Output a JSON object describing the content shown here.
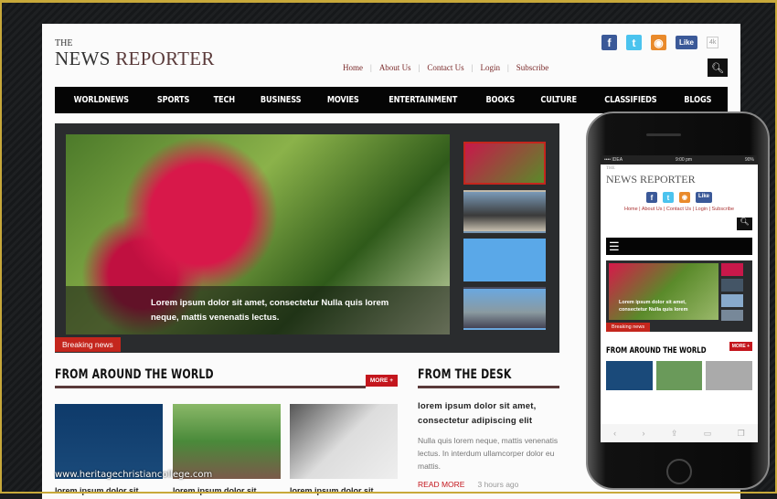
{
  "site": {
    "the": "THE",
    "name_a": "NEWS ",
    "name_b": "REPORTER"
  },
  "social": {
    "facebook": "f",
    "twitter": "t",
    "rss": "rss-icon",
    "like": "Like",
    "like_count": "4k"
  },
  "top_links": [
    "Home",
    "About Us",
    "Contact Us",
    "Login",
    "Subscribe"
  ],
  "nav": [
    "WORLDNEWS",
    "SPORTS",
    "TECH",
    "BUSINESS",
    "MOVIES",
    "ENTERTAINMENT",
    "BOOKS",
    "CULTURE",
    "CLASSIFIEDS",
    "BLOGS"
  ],
  "slider": {
    "caption": "Lorem ipsum dolor sit amet, consectetur Nulla quis lorem neque, mattis venenatis lectus.",
    "breaking": "Breaking news"
  },
  "world": {
    "title": "FROM AROUND THE WORLD",
    "more": "MORE +",
    "card_title": "lorem ipsum dolor sit"
  },
  "desk": {
    "title": "FROM THE DESK",
    "headline": "lorem ipsum dolor sit amet, consectetur adipiscing elit",
    "body": "Nulla quis lorem neque, mattis venenatis lectus. In interdum ullamcorper dolor eu mattis.",
    "read_more": "READ MORE",
    "ago": "3 hours ago"
  },
  "watermark": "www.heritagechristiancollege.com",
  "phone": {
    "carrier": "•••• IDEA",
    "time": "9:00 pm",
    "battery": "90%",
    "title": "THE",
    "name": "NEWS REPORTER",
    "links": "Home | About Us | Contact Us | Login | Subscribe",
    "caption": "Lorem ipsum dolor sit amet, consectetur Nulla quis lorem",
    "breaking": "Breaking news",
    "world": "FROM AROUND THE WORLD",
    "more": "MORE +"
  },
  "colors": {
    "accent": "#c4161d",
    "nav_bg": "#050505",
    "rule": "#5a3a3a"
  }
}
